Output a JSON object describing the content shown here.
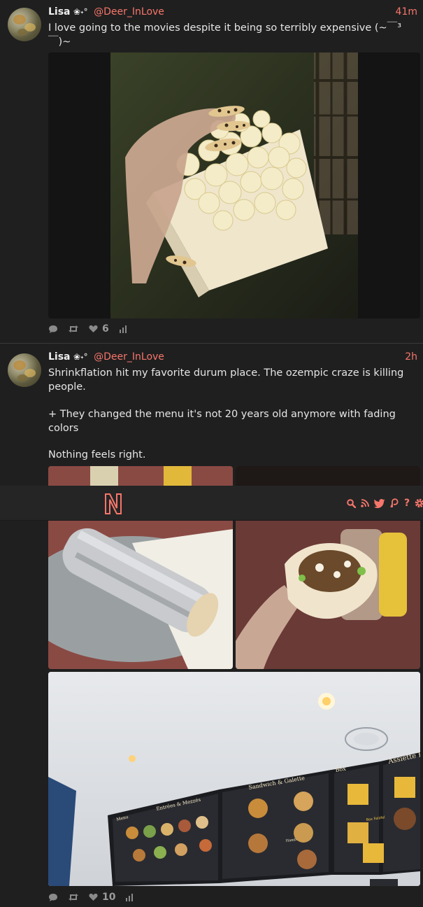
{
  "colors": {
    "accent": "#f7766b",
    "background": "#1f1f1f",
    "navbar": "#252525",
    "text": "#e6e6e6",
    "muted": "#8a8a8a"
  },
  "posts": [
    {
      "author": "Lisa",
      "author_decoration": "❀˖°",
      "handle": "@Deer_InLove",
      "time": "41m",
      "text": "I love going to the movies despite it being so terribly expensive (~￣³￣)~",
      "media": [
        "popcorn box held in hand with leopard-print nails"
      ],
      "actions": {
        "reply_icon": "reply-icon",
        "retweet_icon": "retweet-icon",
        "like_icon": "heart-icon",
        "likes": "6",
        "stats_icon": "stats-icon"
      }
    },
    {
      "author": "Lisa",
      "author_decoration": "❀˖°",
      "handle": "@Deer_InLove",
      "time": "2h",
      "text_lines": [
        "Shrinkflation hit my favorite durum place. The ozempic craze is killing people.",
        "+ They changed the menu it's not 20 years old anymore with fading colors",
        "Nothing feels right."
      ],
      "media": [
        "durum wrapped in foil on a plate",
        "durum held in hand",
        "restaurant menu board on ceiling"
      ],
      "menu_board": {
        "panel1_title": "Entrées & Mezzés",
        "panel1_sub": "Menu",
        "panel2_title": "Sandwich & Galette",
        "panel2_sub": "Hamburger",
        "panel3_title": "Box",
        "panel3_sub": "Box Falafel",
        "panel4_title": "Assiette K"
      },
      "actions": {
        "reply_icon": "reply-icon",
        "retweet_icon": "retweet-icon",
        "like_icon": "heart-icon",
        "likes": "10",
        "stats_icon": "stats-icon"
      }
    }
  ],
  "navbar": {
    "logo": "N",
    "icons": [
      "search-icon",
      "rss-icon",
      "twitter-icon",
      "patreon-icon",
      "help-icon",
      "settings-icon"
    ],
    "help_glyph": "?"
  }
}
